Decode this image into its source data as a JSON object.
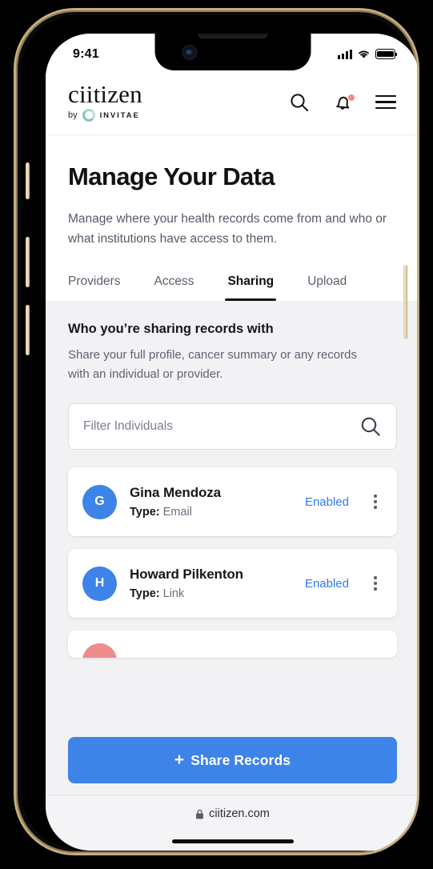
{
  "statusbar": {
    "time": "9:41",
    "signal_icon": "cellular-signal-icon",
    "wifi_icon": "wifi-icon",
    "battery_icon": "battery-full-icon"
  },
  "header": {
    "logo_wordmark": "ciitizen",
    "logo_by_text": "by",
    "logo_parent_brand": "INVITAE",
    "icons": [
      {
        "name": "search-icon",
        "label": "Search"
      },
      {
        "name": "notifications-bell-icon",
        "label": "Notifications",
        "has_badge": true
      },
      {
        "name": "hamburger-menu-icon",
        "label": "Menu"
      }
    ]
  },
  "page": {
    "title": "Manage Your Data",
    "subtitle": "Manage where your health records come from and who or what institutions have access to them."
  },
  "tabs": [
    {
      "label": "Providers",
      "active": false
    },
    {
      "label": "Access",
      "active": false
    },
    {
      "label": "Sharing",
      "active": true
    },
    {
      "label": "Upload",
      "active": false
    }
  ],
  "section": {
    "title": "Who you’re sharing records with",
    "subtitle": "Share your full profile, cancer summary or any records with an individual or provider."
  },
  "filter": {
    "placeholder": "Filter Individuals",
    "value": "",
    "icon": "search-icon"
  },
  "sharing_list": [
    {
      "initial": "G",
      "avatar_color": "#3d83e8",
      "name": "Gina Mendoza",
      "type_label": "Type:",
      "type_value": "Email",
      "status": "Enabled",
      "menu_icon": "kebab-menu-icon"
    },
    {
      "initial": "H",
      "avatar_color": "#3d83e8",
      "name": "Howard Pilkenton",
      "type_label": "Type:",
      "type_value": "Link",
      "status": "Enabled",
      "menu_icon": "kebab-menu-icon"
    },
    {
      "initial": "",
      "avatar_color": "#ef8b8b",
      "name": "",
      "type_label": "",
      "type_value": "",
      "status": "",
      "menu_icon": "kebab-menu-icon"
    }
  ],
  "cta": {
    "plus": "+",
    "label": "Share Records"
  },
  "browser": {
    "lock_icon": "lock-icon",
    "url": "ciitizen.com"
  },
  "colors": {
    "accent_blue": "#3d83e8",
    "status_blue": "#2f7bf0",
    "notification_dot": "#f08a8a",
    "content_bg": "#f2f2f4",
    "brand_ring": "#7fc6c0"
  }
}
